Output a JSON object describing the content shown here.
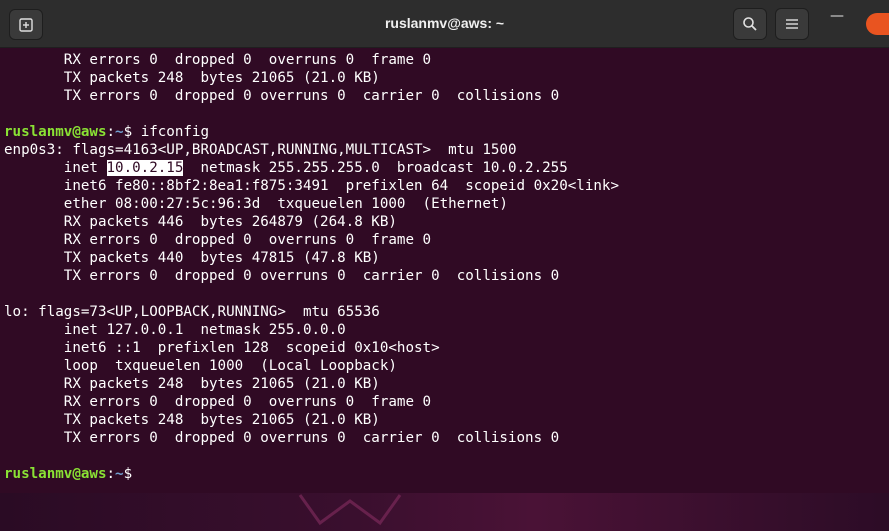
{
  "window": {
    "title": "ruslanmv@aws: ~",
    "minimize_label": "—"
  },
  "terminal": {
    "prompt_user": "ruslanmv@aws",
    "prompt_sep": ":",
    "prompt_path": "~",
    "prompt_symbol": "$",
    "command": "ifconfig",
    "lines": [
      "       RX errors 0  dropped 0  overruns 0  frame 0",
      "       TX packets 248  bytes 21065 (21.0 KB)",
      "       TX errors 0  dropped 0 overruns 0  carrier 0  collisions 0",
      "",
      "__PROMPT_CMD__",
      "enp0s3: flags=4163<UP,BROADCAST,RUNNING,MULTICAST>  mtu 1500",
      "__INET__",
      "       inet6 fe80::8bf2:8ea1:f875:3491  prefixlen 64  scopeid 0x20<link>",
      "       ether 08:00:27:5c:96:3d  txqueuelen 1000  (Ethernet)",
      "       RX packets 446  bytes 264879 (264.8 KB)",
      "       RX errors 0  dropped 0  overruns 0  frame 0",
      "       TX packets 440  bytes 47815 (47.8 KB)",
      "       TX errors 0  dropped 0 overruns 0  carrier 0  collisions 0",
      "",
      "lo: flags=73<UP,LOOPBACK,RUNNING>  mtu 65536",
      "       inet 127.0.0.1  netmask 255.0.0.0",
      "       inet6 ::1  prefixlen 128  scopeid 0x10<host>",
      "       loop  txqueuelen 1000  (Local Loopback)",
      "       RX packets 248  bytes 21065 (21.0 KB)",
      "       RX errors 0  dropped 0  overruns 0  frame 0",
      "       TX packets 248  bytes 21065 (21.0 KB)",
      "       TX errors 0  dropped 0 overruns 0  carrier 0  collisions 0",
      "",
      "__PROMPT__"
    ],
    "inet_prefix": "       inet ",
    "inet_selected": "10.0.2.15",
    "inet_suffix": "  netmask 255.255.255.0  broadcast 10.0.2.255"
  },
  "colors": {
    "terminal_bg": "#300a24",
    "prompt_user": "#8ae234",
    "prompt_path": "#729fcf",
    "accent": "#e95420"
  },
  "icons": [
    "new-tab-icon",
    "search-icon",
    "hamburger-menu-icon",
    "minimize-icon",
    "close-icon"
  ]
}
